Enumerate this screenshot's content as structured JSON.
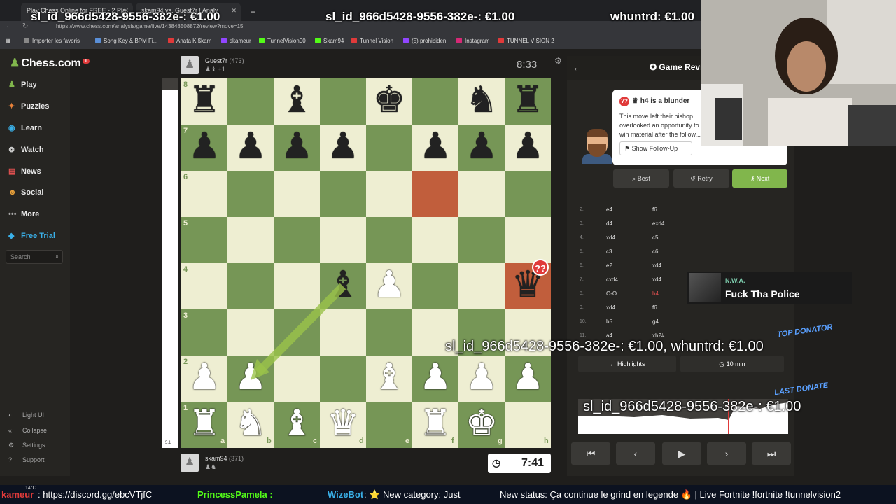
{
  "browser": {
    "tabs": [
      {
        "title": "Play Chess Online for FREE - 2 Pla"
      },
      {
        "title": "skam94 vs. Guest7r | Analy"
      }
    ],
    "url": "https://www.chess.com/analysis/game/live/143848508872/review?move=15",
    "bookmarks": [
      "Importer les favoris",
      "Song Key & BPM Fi...",
      "Anata K $kam",
      "skameur",
      "TunnelVision00",
      "Skam94",
      "Tunnel Vision",
      "(5) prohibiden",
      "Instagram",
      "TUNNEL VISION 2"
    ]
  },
  "stream_overlays": {
    "top_donations": [
      "sl_id_966d5428-9556-382e-: €1.00",
      "sl_id_966d5428-9556-382e-: €1.00",
      "whuntrd: €1.00"
    ],
    "top_donator_label": "TOP DONATOR",
    "top_donator_text": "sl_id_966d5428-9556-382e-: €1.00, whuntrd: €1.00",
    "last_donate_label": "LAST DONATE",
    "last_donate_text": "sl_id_966d5428-9556-382e-: €1.00",
    "song": {
      "artist": "N.W.A.",
      "title": "Fuck Tha Police"
    },
    "ticker": {
      "left_label": "kameur",
      "weather": "14°C",
      "discord": ": https://discord.gg/ebcVTjfC",
      "user": "PrincessPamela :",
      "bot": "WizeBot",
      "message1": ": ⭐ New category: Just",
      "message2": "New status: Ça continue le grind en legende 🔥 | Live Fortnite !fortnite !tunnelvision2"
    }
  },
  "sidebar": {
    "logo": "Chess.com",
    "notif": "1",
    "items": [
      {
        "label": "Play",
        "icon": "play-icon"
      },
      {
        "label": "Puzzles",
        "icon": "puzzle-icon"
      },
      {
        "label": "Learn",
        "icon": "learn-icon"
      },
      {
        "label": "Watch",
        "icon": "binoculars-icon"
      },
      {
        "label": "News",
        "icon": "news-icon"
      },
      {
        "label": "Social",
        "icon": "social-icon"
      },
      {
        "label": "More",
        "icon": "more-icon"
      }
    ],
    "free_trial": "Free Trial",
    "search_placeholder": "Search",
    "footer": [
      "Light UI",
      "Collapse",
      "Settings",
      "Support"
    ]
  },
  "game": {
    "top_player": {
      "name": "Guest7r",
      "rating": "(473)",
      "material": "+1"
    },
    "bottom_player": {
      "name": "skam94",
      "rating": "(371)"
    },
    "top_clock": "8:33",
    "bottom_clock": "7:41",
    "eval_value": "5.1",
    "eval_white_fraction": 0.97,
    "ranks": [
      "8",
      "7",
      "6",
      "5",
      "4",
      "3",
      "2",
      "1"
    ],
    "files": [
      "a",
      "b",
      "c",
      "d",
      "e",
      "f",
      "g",
      "h"
    ],
    "position": [
      [
        "r",
        "",
        "b",
        "",
        "k",
        "",
        "n",
        "r"
      ],
      [
        "p",
        "p",
        "p",
        "p",
        "",
        "p",
        "p",
        "p"
      ],
      [
        "",
        "",
        "",
        "",
        "",
        "",
        "",
        ""
      ],
      [
        "",
        "",
        "",
        "",
        "",
        "",
        "",
        ""
      ],
      [
        "",
        "",
        "",
        "b",
        "P",
        "",
        "",
        "q"
      ],
      [
        "",
        "",
        "",
        "",
        "",
        "",
        "",
        ""
      ],
      [
        "P",
        "P",
        "",
        "",
        "B",
        "P",
        "P",
        "P"
      ],
      [
        "R",
        "N",
        "B",
        "Q",
        "",
        "R",
        "K",
        ""
      ]
    ],
    "highlight_squares": [
      "f6",
      "h4"
    ],
    "blunder_mark": "??",
    "arrow": {
      "from": "d4",
      "to": "b2"
    }
  },
  "review": {
    "title": "Game Review",
    "bubble": {
      "headline": "h4 is a blunder",
      "description": "This move left their bishop... overlooked an opportunity to win material after the follow...",
      "follow_up": "Show Follow-Up"
    },
    "buttons": {
      "best": "Best",
      "retry": "Retry",
      "next": "Next"
    },
    "moves": [
      {
        "n": "2.",
        "w": "e4",
        "b": "f6"
      },
      {
        "n": "3.",
        "w": "d4",
        "b": "exd4"
      },
      {
        "n": "4.",
        "w": "xd4",
        "b": "c5"
      },
      {
        "n": "5.",
        "w": "c3",
        "b": "c6"
      },
      {
        "n": "6.",
        "w": "e2",
        "b": "xd4"
      },
      {
        "n": "7.",
        "w": "cxd4",
        "b": "xd4"
      },
      {
        "n": "8.",
        "w": "O-O",
        "b": "h4"
      },
      {
        "n": "9.",
        "w": "xd4",
        "b": "f6"
      },
      {
        "n": "10.",
        "w": "b5",
        "b": "g4"
      },
      {
        "n": "11.",
        "w": "a4",
        "b": "xh2#"
      }
    ],
    "highlights": "Highlights",
    "duration": "10 min"
  }
}
